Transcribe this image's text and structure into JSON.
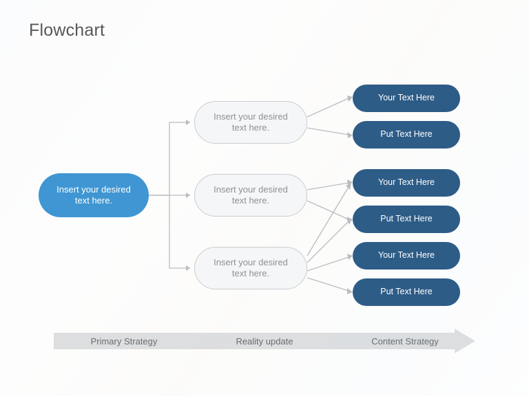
{
  "title": "Flowchart",
  "root": {
    "text": "Insert your desired text here."
  },
  "level2": [
    {
      "text": "Insert your desired text here."
    },
    {
      "text": "Insert your desired text here."
    },
    {
      "text": "Insert your desired text here."
    }
  ],
  "level3": [
    {
      "text": "Your Text Here"
    },
    {
      "text": "Put Text Here"
    },
    {
      "text": "Your Text Here"
    },
    {
      "text": "Put Text Here"
    },
    {
      "text": "Your Text Here"
    },
    {
      "text": "Put Text Here"
    }
  ],
  "axis": {
    "labels": [
      "Primary Strategy",
      "Reality update",
      "Content Strategy"
    ]
  },
  "colors": {
    "root": "#3f96d2",
    "leaf": "#2d5c87",
    "midFill": "#f5f6f7",
    "midBorder": "#c9ccce",
    "arrow": "#c1c5c8",
    "connector": "#b9bdc0"
  }
}
